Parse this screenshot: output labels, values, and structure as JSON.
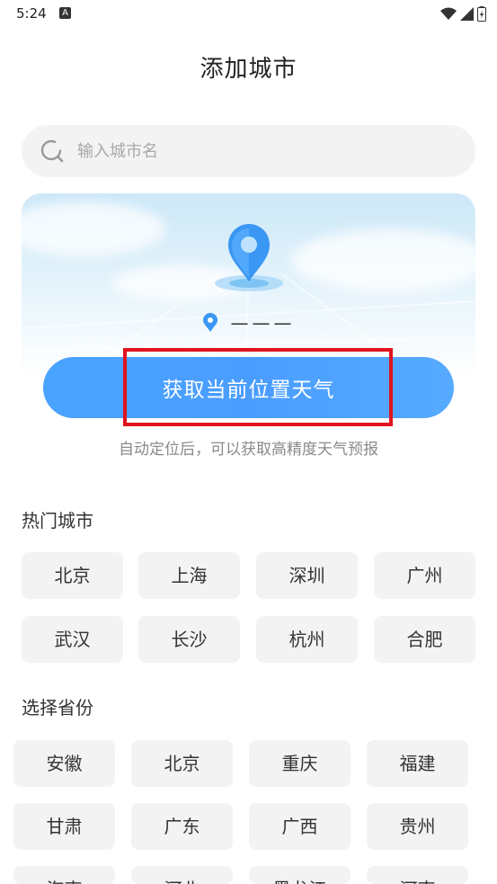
{
  "status": {
    "time": "5:24",
    "notification_badge": "A"
  },
  "page": {
    "title": "添加城市"
  },
  "search": {
    "placeholder": "输入城市名"
  },
  "locate": {
    "current_location": "———",
    "button_label": "获取当前位置天气",
    "hint": "自动定位后，可以获取高精度天气预报",
    "accent_color": "#4a9dff",
    "highlight_color": "#e1141e"
  },
  "hot_cities": {
    "title": "热门城市",
    "items": [
      "北京",
      "上海",
      "深圳",
      "广州",
      "武汉",
      "长沙",
      "杭州",
      "合肥"
    ]
  },
  "provinces": {
    "title": "选择省份",
    "items": [
      "安徽",
      "北京",
      "重庆",
      "福建",
      "甘肃",
      "广东",
      "广西",
      "贵州",
      "海南",
      "河北",
      "黑龙江",
      "河南"
    ]
  }
}
